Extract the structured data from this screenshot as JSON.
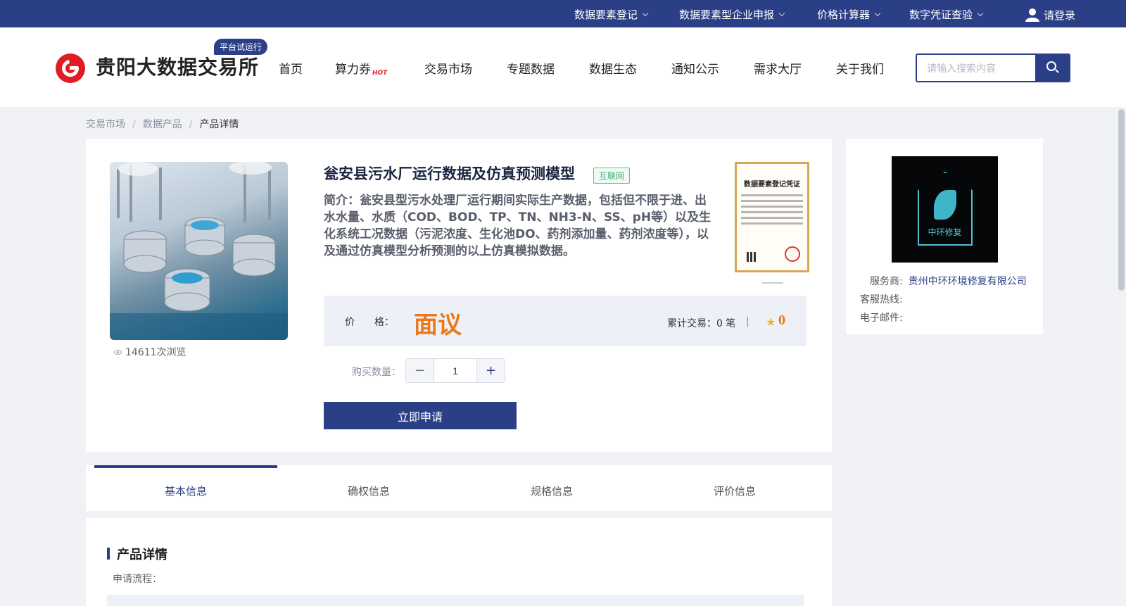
{
  "topbar": {
    "links": [
      "数据要素登记",
      "数据要素型企业申报",
      "价格计算器",
      "数字凭证查验"
    ],
    "login": "请登录",
    "icons": [
      "chevron-down-icon",
      "user-icon"
    ]
  },
  "header": {
    "logo_text": "贵阳大数据交易所",
    "badge": "平台试运行",
    "nav": [
      "首页",
      "算力券",
      "交易市场",
      "专题数据",
      "数据生态",
      "通知公示",
      "需求大厅",
      "关于我们"
    ],
    "hot_badge": "HOT",
    "search_placeholder": "请输入搜索内容"
  },
  "breadcrumb": [
    "交易市场",
    "数据产品",
    "产品详情"
  ],
  "product": {
    "title": "瓮安县污水厂运行数据及仿真预测模型",
    "tag": "互联网",
    "intro": "简介：瓮安县型污水处理厂运行期间实际生产数据，包括但不限于进、出水水量、水质（COD、BOD、TP、TN、NH3-N、SS、pH等）以及生化系统工况数据（污泥浓度、生化池DO、药剂添加量、药剂浓度等），以及通过仿真模型分析预测的以上仿真模拟数据。",
    "views": "14611次浏览",
    "certificate_title": "数据要素登记凭证",
    "price_label": "价　　格：",
    "price": "面议",
    "trade": "累计交易：0 笔",
    "separator": "|",
    "score": "0",
    "qty_label": "购买数量：",
    "qty": "1",
    "apply": "立即申请"
  },
  "vendor": {
    "logo_text": "中环修复",
    "service_label": "服务商:",
    "service_value": "贵州中环环境修复有限公司",
    "hotline_label": "客服热线:",
    "email_label": "电子邮件:"
  },
  "tabs": [
    "基本信息",
    "确权信息",
    "规格信息",
    "评价信息"
  ],
  "detail": {
    "title": "产品详情",
    "flow_label": "申请流程："
  },
  "colors": {
    "primary": "#2b3f86",
    "price": "#e8791d",
    "logo_red": "#e01d24",
    "tag_green": "#3fae6f"
  }
}
